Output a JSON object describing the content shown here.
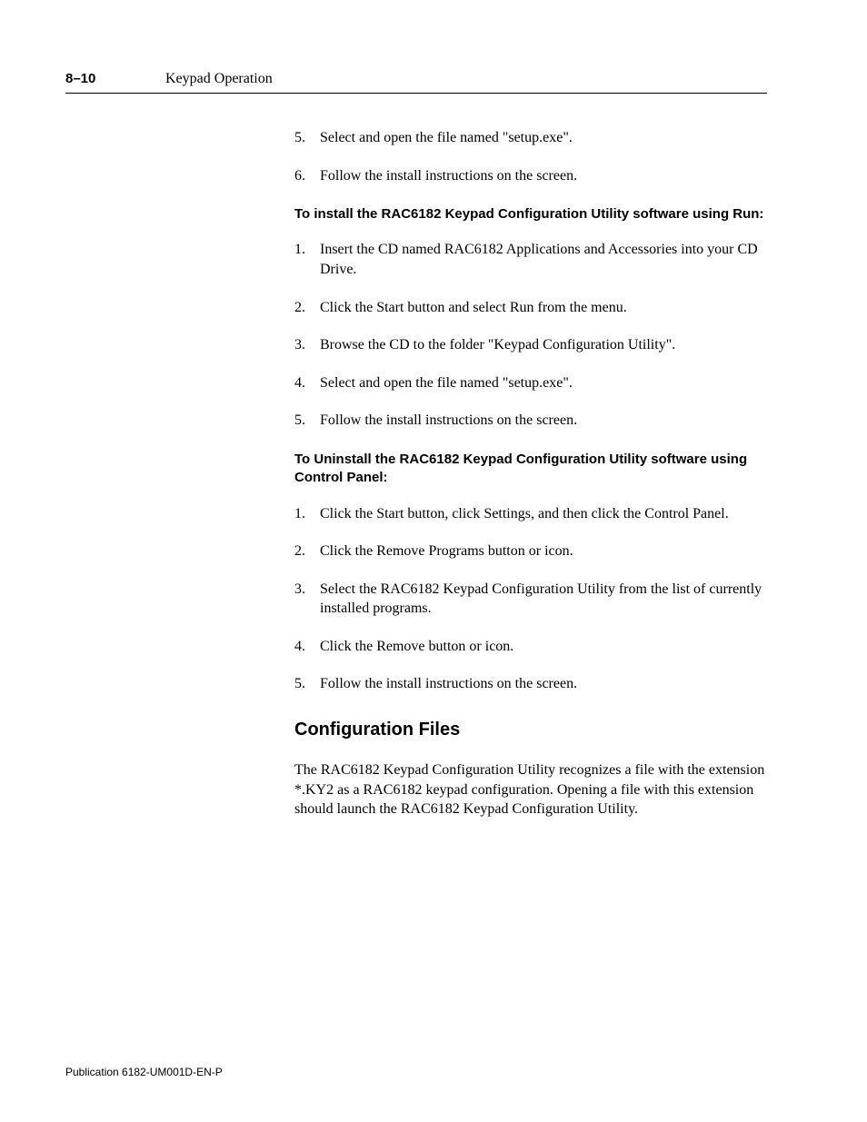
{
  "header": {
    "page_number": "8–10",
    "title": "Keypad Operation"
  },
  "list_a": [
    {
      "n": "5.",
      "t": "Select and open the file named \"setup.exe\"."
    },
    {
      "n": "6.",
      "t": "Follow the install instructions on the screen."
    }
  ],
  "sub1": "To install the RAC6182 Keypad Configuration Utility software using Run:",
  "list_b": [
    {
      "n": "1.",
      "t": "Insert the CD named RAC6182 Applications and Accessories into your CD Drive."
    },
    {
      "n": "2.",
      "t": "Click the Start button and select Run from the menu."
    },
    {
      "n": "3.",
      "t": "Browse the CD to the folder \"Keypad Configuration Utility\"."
    },
    {
      "n": "4.",
      "t": "Select and open the file named \"setup.exe\"."
    },
    {
      "n": "5.",
      "t": "Follow the install instructions on the screen."
    }
  ],
  "sub2": "To Uninstall the RAC6182 Keypad Configuration Utility software using Control Panel:",
  "list_c": [
    {
      "n": "1.",
      "t": "Click the Start button, click Settings, and then click the Control Panel."
    },
    {
      "n": "2.",
      "t": "Click the Remove Programs button or icon."
    },
    {
      "n": "3.",
      "t": "Select the RAC6182 Keypad Configuration Utility from the list of currently installed programs."
    },
    {
      "n": "4.",
      "t": "Click the Remove button or icon."
    },
    {
      "n": "5.",
      "t": "Follow the install instructions on the screen."
    }
  ],
  "section_heading": "Configuration Files",
  "paragraph": "The RAC6182 Keypad Configuration Utility recognizes a file with the extension *.KY2 as a RAC6182 keypad configuration.  Opening a file with this extension should launch the RAC6182 Keypad Configuration Utility.",
  "footer": "Publication 6182-UM001D-EN-P"
}
